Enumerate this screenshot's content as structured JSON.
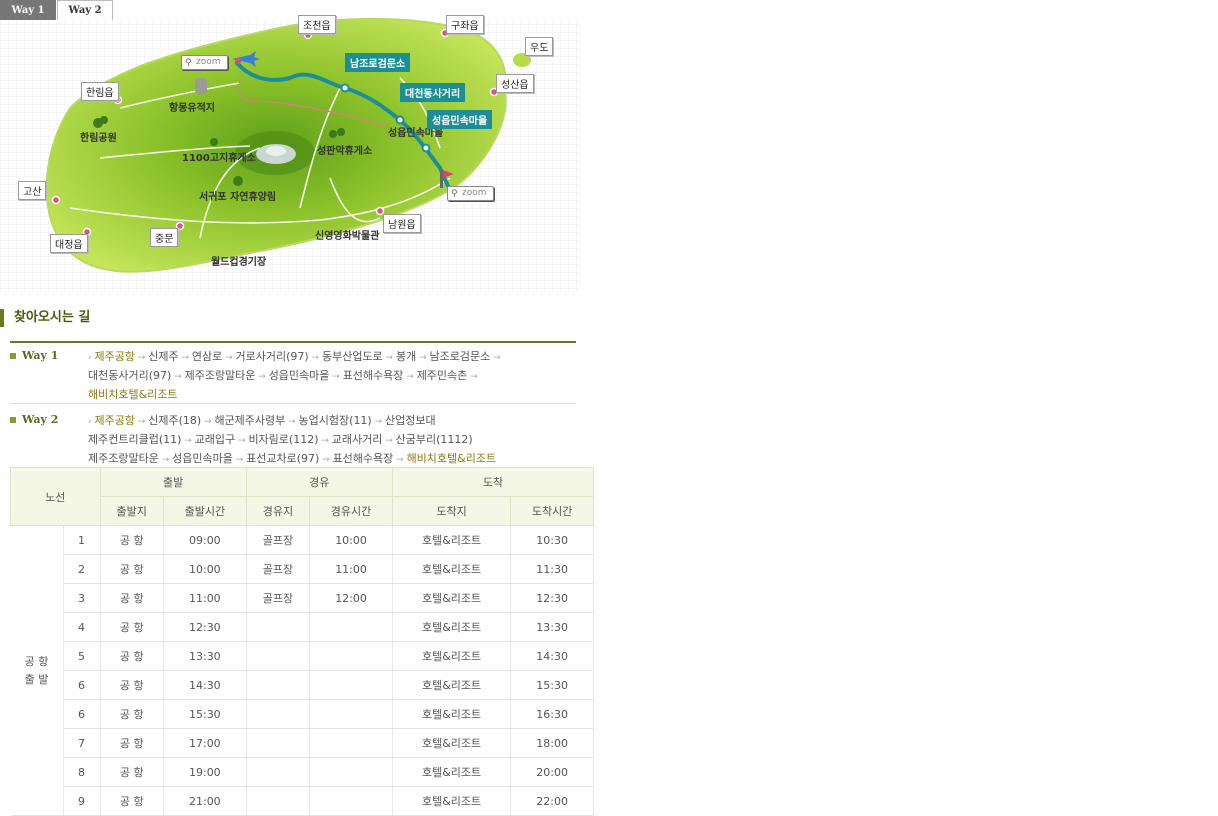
{
  "tabs": [
    {
      "label": "Way 1",
      "active": true
    },
    {
      "label": "Way 2",
      "active": false
    }
  ],
  "map": {
    "zoom_label": "zoom",
    "places": {
      "jocheon": "조천읍",
      "gujwa": "구좌읍",
      "udo": "우도",
      "seongsan": "성산읍",
      "hallim": "한림읍",
      "hangmong": "항몽유적지",
      "hallim_park": "한림공원",
      "rest1100": "1100고지휴게소",
      "seopanak": "성판악휴게소",
      "seogwipo": "서귀포 자연휴양림",
      "gosan": "고산",
      "daejeong": "대정읍",
      "jungmun": "중문",
      "namwon": "남원읍",
      "cinema": "신영영화박물관",
      "worldcup": "월드컵경기장",
      "seongeup_village": "성읍민속마을"
    },
    "route_stops": [
      "남조로검문소",
      "대천동사거리",
      "성읍민속마을"
    ]
  },
  "section_title": "찾아오시는 길",
  "ways": [
    {
      "label": "Way 1",
      "lines": [
        [
          {
            "t": "제주공항",
            "hl": true
          },
          {
            "t": "신제주"
          },
          {
            "t": "연삼로"
          },
          {
            "t": "거로사거리(97)"
          },
          {
            "t": "동부산업도로"
          },
          {
            "t": "봉개"
          },
          {
            "t": "남조로검문소",
            "end": true
          }
        ],
        [
          {
            "t": "대천동사거리(97)"
          },
          {
            "t": "제주조랑말타운"
          },
          {
            "t": "성읍민속마을"
          },
          {
            "t": "표선해수욕장"
          },
          {
            "t": "제주민속촌",
            "end": true
          }
        ],
        [
          {
            "t": "해비치호텔&리조트",
            "hl": true,
            "last": true
          }
        ]
      ]
    },
    {
      "label": "Way 2",
      "lines": [
        [
          {
            "t": "제주공항",
            "hl": true
          },
          {
            "t": "신제주(18)"
          },
          {
            "t": "해군제주사령부"
          },
          {
            "t": "농업시험장(11)"
          },
          {
            "t": "산업정보대",
            "last": true
          }
        ],
        [
          {
            "t": "제주컨트리클럽(11)"
          },
          {
            "t": "교래입구"
          },
          {
            "t": "비자림로(112)"
          },
          {
            "t": "교래사거리"
          },
          {
            "t": "산굼부리(1112)",
            "last": true
          }
        ],
        [
          {
            "t": "제주조랑말타운"
          },
          {
            "t": "성읍민속마을"
          },
          {
            "t": "표선교차로(97)"
          },
          {
            "t": "표선해수욕장"
          },
          {
            "t": "해비치호텔&리조트",
            "hl": true,
            "last": true
          }
        ]
      ]
    }
  ],
  "table": {
    "header_top": {
      "route": "노선",
      "departure": "출발",
      "via": "경유",
      "arrival": "도착"
    },
    "header_sub": [
      "출발지",
      "출발시간",
      "경유지",
      "경유시간",
      "도착지",
      "도착시간"
    ],
    "route_name": [
      "공 항",
      "출 발"
    ],
    "rows": [
      {
        "no": "1",
        "from": "공 항",
        "dep": "09:00",
        "via": "골프장",
        "via_time": "10:00",
        "to": "호텔&리조트",
        "arr": "10:30"
      },
      {
        "no": "2",
        "from": "공 항",
        "dep": "10:00",
        "via": "골프장",
        "via_time": "11:00",
        "to": "호텔&리조트",
        "arr": "11:30"
      },
      {
        "no": "3",
        "from": "공 항",
        "dep": "11:00",
        "via": "골프장",
        "via_time": "12:00",
        "to": "호텔&리조트",
        "arr": "12:30"
      },
      {
        "no": "4",
        "from": "공 항",
        "dep": "12:30",
        "via": "",
        "via_time": "",
        "to": "호텔&리조트",
        "arr": "13:30"
      },
      {
        "no": "5",
        "from": "공 항",
        "dep": "13:30",
        "via": "",
        "via_time": "",
        "to": "호텔&리조트",
        "arr": "14:30"
      },
      {
        "no": "6",
        "from": "공 항",
        "dep": "14:30",
        "via": "",
        "via_time": "",
        "to": "호텔&리조트",
        "arr": "15:30"
      },
      {
        "no": "6",
        "from": "공 항",
        "dep": "15:30",
        "via": "",
        "via_time": "",
        "to": "호텔&리조트",
        "arr": "16:30"
      },
      {
        "no": "7",
        "from": "공 항",
        "dep": "17:00",
        "via": "",
        "via_time": "",
        "to": "호텔&리조트",
        "arr": "18:00"
      },
      {
        "no": "8",
        "from": "공 항",
        "dep": "19:00",
        "via": "",
        "via_time": "",
        "to": "호텔&리조트",
        "arr": "20:00"
      },
      {
        "no": "9",
        "from": "공 항",
        "dep": "21:00",
        "via": "",
        "via_time": "",
        "to": "호텔&리조트",
        "arr": "22:00"
      }
    ]
  },
  "colors": {
    "accent": "#6b7a1e",
    "route": "#1c8f96",
    "highlight": "#8a7a10",
    "island": "#9ccc2e"
  }
}
